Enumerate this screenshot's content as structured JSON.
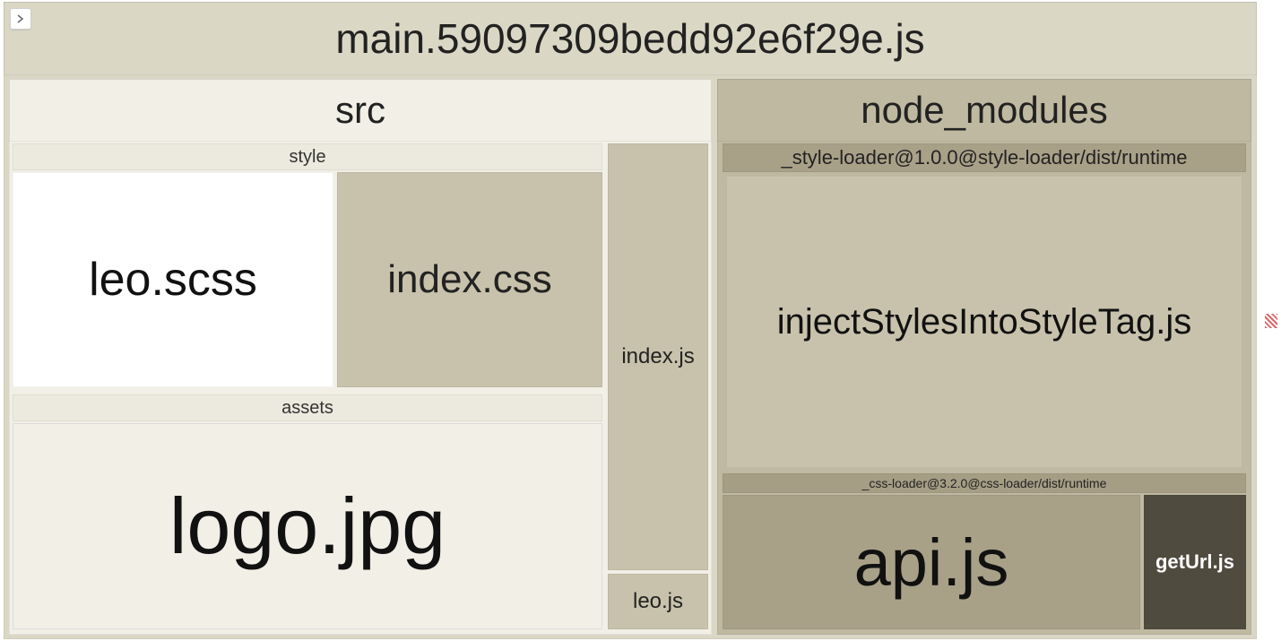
{
  "root": {
    "title": "main.59097309bedd92e6f29e.js"
  },
  "src": {
    "label": "src",
    "style": {
      "label": "style",
      "leo_scss": "leo.scss",
      "index_css": "index.css"
    },
    "assets": {
      "label": "assets",
      "logo_jpg": "logo.jpg"
    },
    "index_js": "index.js",
    "leo_js": "leo.js"
  },
  "node_modules": {
    "label": "node_modules",
    "style_loader": {
      "label": "_style-loader@1.0.0@style-loader/dist/runtime",
      "file": "injectStylesIntoStyleTag.js"
    },
    "css_loader": {
      "label": "_css-loader@3.2.0@css-loader/dist/runtime",
      "api_js": "api.js",
      "geturl_js": "getUrl.js"
    }
  }
}
